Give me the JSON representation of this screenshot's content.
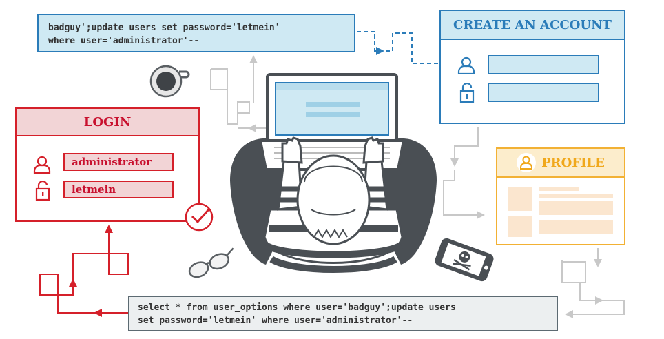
{
  "sql_top": {
    "line1": "badguy';update users set password='letmein'",
    "line2": "where user='administrator'--"
  },
  "sql_bottom": {
    "line1": "select * from user_options where user='badguy';update users",
    "line2": "set password='letmein' where user='administrator'--"
  },
  "login": {
    "title": "LOGIN",
    "username": "administrator",
    "password": "letmein"
  },
  "create_account": {
    "title": "CREATE AN ACCOUNT"
  },
  "profile": {
    "title": "PROFILE"
  },
  "colors": {
    "red": "#d5202a",
    "blue": "#2b7cb9",
    "orange": "#f2b134",
    "gray": "#4a4f54"
  },
  "icons": [
    "user-icon",
    "padlock-icon",
    "checkmark-icon",
    "coffee-cup-icon",
    "glasses-icon",
    "skull-phone-icon",
    "laptop-icon",
    "hacker-figure"
  ]
}
